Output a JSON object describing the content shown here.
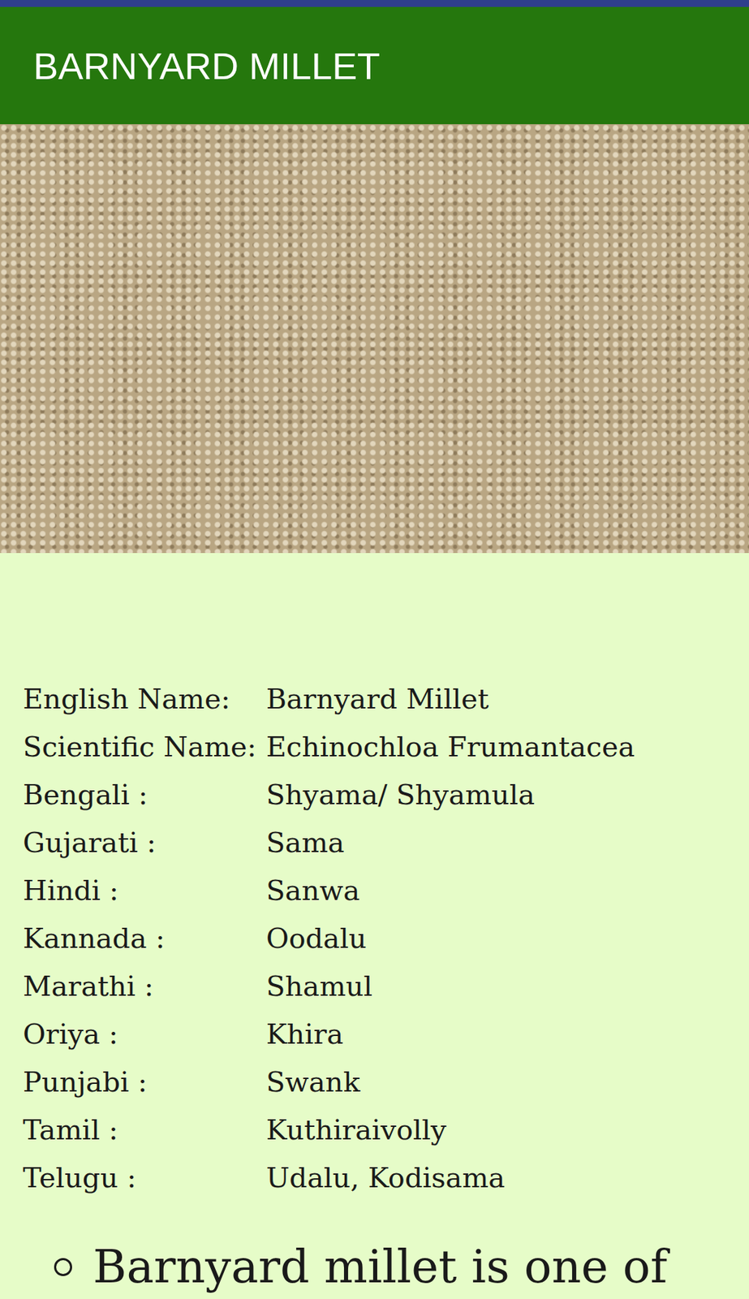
{
  "app_bar": {
    "title": "BARNYARD MILLET"
  },
  "names": [
    {
      "label": "English Name:",
      "value": "Barnyard Millet"
    },
    {
      "label": "Scientific Name:",
      "value": "Echinochloa Frumantacea"
    },
    {
      "label": "Bengali :",
      "value": "Shyama/ Shyamula"
    },
    {
      "label": "Gujarati :",
      "value": "Sama"
    },
    {
      "label": "Hindi :",
      "value": "Sanwa"
    },
    {
      "label": "Kannada :",
      "value": "Oodalu"
    },
    {
      "label": "Marathi :",
      "value": "Shamul"
    },
    {
      "label": "Oriya :",
      "value": "Khira"
    },
    {
      "label": "Punjabi :",
      "value": "Swank"
    },
    {
      "label": "Tamil :",
      "value": "Kuthiraivolly"
    },
    {
      "label": "Telugu :",
      "value": "Udalu, Kodisama"
    }
  ],
  "bullets": [
    "Barnyard millet is one of"
  ]
}
